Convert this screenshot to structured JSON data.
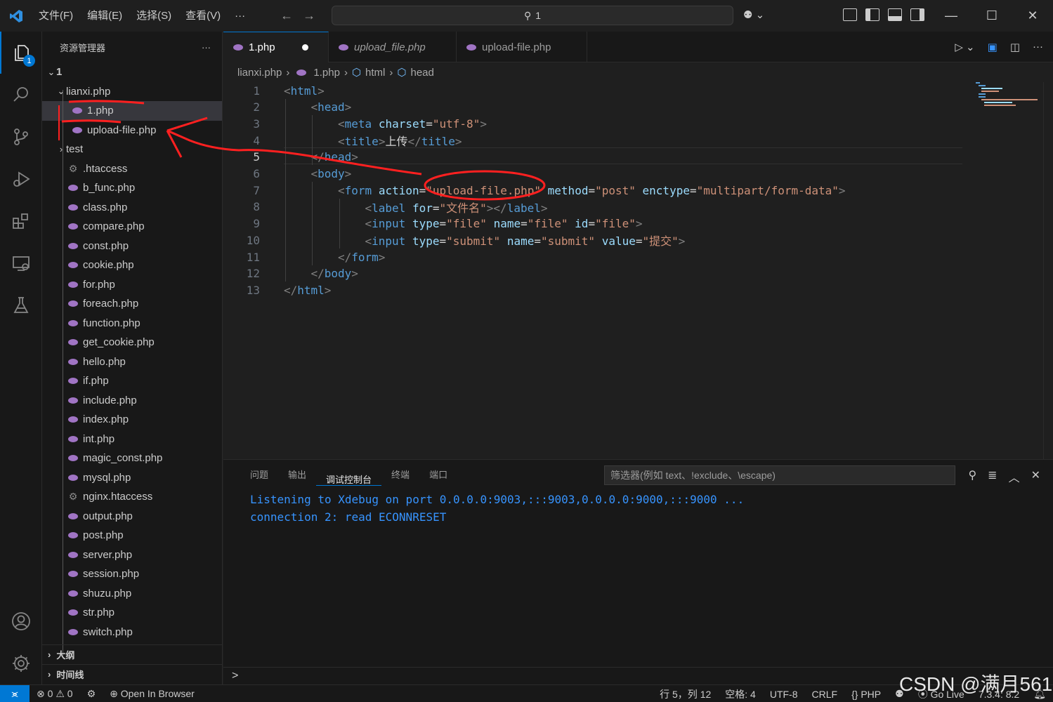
{
  "titlebar": {
    "menu": [
      "文件(F)",
      "编辑(E)",
      "选择(S)",
      "查看(V)",
      "···"
    ],
    "search": "1"
  },
  "activity": {
    "explorer_badge": "1"
  },
  "sidebar": {
    "title": "资源管理器",
    "more": "···",
    "tree": [
      {
        "label": "1",
        "type": "folder-open",
        "depth": 0
      },
      {
        "label": "lianxi.php",
        "type": "folder-open",
        "depth": 1
      },
      {
        "label": "1.php",
        "type": "php",
        "depth": 2,
        "selected": true
      },
      {
        "label": "upload-file.php",
        "type": "php",
        "depth": 2
      },
      {
        "label": "test",
        "type": "folder",
        "depth": 1
      },
      {
        "label": ".htaccess",
        "type": "gear",
        "depth": 1
      },
      {
        "label": "b_func.php",
        "type": "php",
        "depth": 1
      },
      {
        "label": "class.php",
        "type": "php",
        "depth": 1
      },
      {
        "label": "compare.php",
        "type": "php",
        "depth": 1
      },
      {
        "label": "const.php",
        "type": "php",
        "depth": 1
      },
      {
        "label": "cookie.php",
        "type": "php",
        "depth": 1
      },
      {
        "label": "for.php",
        "type": "php",
        "depth": 1
      },
      {
        "label": "foreach.php",
        "type": "php",
        "depth": 1
      },
      {
        "label": "function.php",
        "type": "php",
        "depth": 1
      },
      {
        "label": "get_cookie.php",
        "type": "php",
        "depth": 1
      },
      {
        "label": "hello.php",
        "type": "php",
        "depth": 1
      },
      {
        "label": "if.php",
        "type": "php",
        "depth": 1
      },
      {
        "label": "include.php",
        "type": "php",
        "depth": 1
      },
      {
        "label": "index.php",
        "type": "php",
        "depth": 1
      },
      {
        "label": "int.php",
        "type": "php",
        "depth": 1
      },
      {
        "label": "magic_const.php",
        "type": "php",
        "depth": 1
      },
      {
        "label": "mysql.php",
        "type": "php",
        "depth": 1
      },
      {
        "label": "nginx.htaccess",
        "type": "gear",
        "depth": 1
      },
      {
        "label": "output.php",
        "type": "php",
        "depth": 1
      },
      {
        "label": "post.php",
        "type": "php",
        "depth": 1
      },
      {
        "label": "server.php",
        "type": "php",
        "depth": 1
      },
      {
        "label": "session.php",
        "type": "php",
        "depth": 1
      },
      {
        "label": "shuzu.php",
        "type": "php",
        "depth": 1
      },
      {
        "label": "str.php",
        "type": "php",
        "depth": 1
      },
      {
        "label": "switch.php",
        "type": "php",
        "depth": 1
      }
    ],
    "outline": "大纲",
    "timeline": "时间线"
  },
  "tabs": [
    {
      "label": "1.php",
      "active": true,
      "dirty": true
    },
    {
      "label": "upload_file.php",
      "italic": true
    },
    {
      "label": "upload-file.php"
    }
  ],
  "breadcrumb": [
    "lianxi.php",
    "1.php",
    "html",
    "head"
  ],
  "code": [
    {
      "n": "1",
      "indent": 0,
      "parts": [
        [
          "br",
          "<"
        ],
        [
          "tg",
          "html"
        ],
        [
          "br",
          ">"
        ]
      ]
    },
    {
      "n": "2",
      "indent": 1,
      "parts": [
        [
          "br",
          "<"
        ],
        [
          "tg",
          "head"
        ],
        [
          "br",
          ">"
        ]
      ]
    },
    {
      "n": "3",
      "indent": 2,
      "parts": [
        [
          "br",
          "<"
        ],
        [
          "tg",
          "meta"
        ],
        [
          "tx",
          " "
        ],
        [
          "at",
          "charset"
        ],
        [
          "tx",
          "="
        ],
        [
          "st",
          "\"utf-8\""
        ],
        [
          "br",
          ">"
        ]
      ]
    },
    {
      "n": "4",
      "indent": 2,
      "parts": [
        [
          "br",
          "<"
        ],
        [
          "tg",
          "title"
        ],
        [
          "br",
          ">"
        ],
        [
          "tx",
          "上传"
        ],
        [
          "br",
          "</"
        ],
        [
          "tg",
          "title"
        ],
        [
          "br",
          ">"
        ]
      ]
    },
    {
      "n": "5",
      "indent": 1,
      "parts": [
        [
          "br",
          "</"
        ],
        [
          "tg",
          "head"
        ],
        [
          "br",
          ">"
        ]
      ]
    },
    {
      "n": "6",
      "indent": 1,
      "parts": [
        [
          "br",
          "<"
        ],
        [
          "tg",
          "body"
        ],
        [
          "br",
          ">"
        ]
      ]
    },
    {
      "n": "7",
      "indent": 2,
      "parts": [
        [
          "br",
          "<"
        ],
        [
          "tg",
          "form"
        ],
        [
          "tx",
          " "
        ],
        [
          "at",
          "action"
        ],
        [
          "tx",
          "="
        ],
        [
          "st",
          "\"upload-file.php\""
        ],
        [
          "tx",
          " "
        ],
        [
          "at",
          "method"
        ],
        [
          "tx",
          "="
        ],
        [
          "st",
          "\"post\""
        ],
        [
          "tx",
          " "
        ],
        [
          "at",
          "enctype"
        ],
        [
          "tx",
          "="
        ],
        [
          "st",
          "\"multipart/form-data\""
        ],
        [
          "br",
          ">"
        ]
      ]
    },
    {
      "n": "8",
      "indent": 3,
      "parts": [
        [
          "br",
          "<"
        ],
        [
          "tg",
          "label"
        ],
        [
          "tx",
          " "
        ],
        [
          "at",
          "for"
        ],
        [
          "tx",
          "="
        ],
        [
          "st",
          "\"文件名\""
        ],
        [
          "br",
          "></"
        ],
        [
          "tg",
          "label"
        ],
        [
          "br",
          ">"
        ]
      ]
    },
    {
      "n": "9",
      "indent": 3,
      "parts": [
        [
          "br",
          "<"
        ],
        [
          "tg",
          "input"
        ],
        [
          "tx",
          " "
        ],
        [
          "at",
          "type"
        ],
        [
          "tx",
          "="
        ],
        [
          "st",
          "\"file\""
        ],
        [
          "tx",
          " "
        ],
        [
          "at",
          "name"
        ],
        [
          "tx",
          "="
        ],
        [
          "st",
          "\"file\""
        ],
        [
          "tx",
          " "
        ],
        [
          "at",
          "id"
        ],
        [
          "tx",
          "="
        ],
        [
          "st",
          "\"file\""
        ],
        [
          "br",
          ">"
        ]
      ]
    },
    {
      "n": "10",
      "indent": 3,
      "parts": [
        [
          "br",
          "<"
        ],
        [
          "tg",
          "input"
        ],
        [
          "tx",
          " "
        ],
        [
          "at",
          "type"
        ],
        [
          "tx",
          "="
        ],
        [
          "st",
          "\"submit\""
        ],
        [
          "tx",
          " "
        ],
        [
          "at",
          "name"
        ],
        [
          "tx",
          "="
        ],
        [
          "st",
          "\"submit\""
        ],
        [
          "tx",
          " "
        ],
        [
          "at",
          "value"
        ],
        [
          "tx",
          "="
        ],
        [
          "st",
          "\"提交\""
        ],
        [
          "br",
          ">"
        ]
      ]
    },
    {
      "n": "11",
      "indent": 2,
      "parts": [
        [
          "br",
          "</"
        ],
        [
          "tg",
          "form"
        ],
        [
          "br",
          ">"
        ]
      ]
    },
    {
      "n": "12",
      "indent": 1,
      "parts": [
        [
          "br",
          "</"
        ],
        [
          "tg",
          "body"
        ],
        [
          "br",
          ">"
        ]
      ]
    },
    {
      "n": "13",
      "indent": 0,
      "parts": [
        [
          "br",
          "</"
        ],
        [
          "tg",
          "html"
        ],
        [
          "br",
          ">"
        ]
      ]
    }
  ],
  "panel": {
    "tabs": [
      "问题",
      "输出",
      "调试控制台",
      "终端",
      "端口"
    ],
    "active_tab": "调试控制台",
    "filter_placeholder": "筛选器(例如 text、!exclude、\\escape)",
    "output": [
      "Listening to Xdebug on port 0.0.0.0:9003,:::9003,0.0.0.0:9000,:::9000 ...",
      "connection 2: read ECONNRESET"
    ],
    "repl_prompt": ">"
  },
  "statusbar": {
    "errors": "0",
    "warnings": "0",
    "open_in_browser": "Open In Browser",
    "position": "行 5，列 12",
    "spaces": "空格: 4",
    "encoding": "UTF-8",
    "eol": "CRLF",
    "language": "PHP",
    "go_live": "Go Live",
    "php_version": "7.3.4: 8.2"
  },
  "watermark": "CSDN @满月561",
  "colors": {
    "accent": "#0078d4",
    "annotation": "#ff2020",
    "php_icon": "#a074c4"
  }
}
